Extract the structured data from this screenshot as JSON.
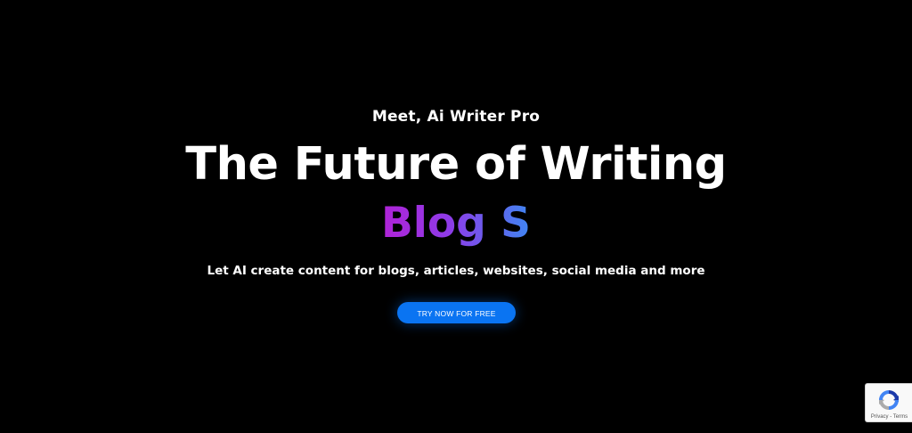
{
  "hero": {
    "eyebrow": "Meet, Ai Writer Pro",
    "headline": "The Future of Writing",
    "typed_text": "Blog S",
    "subheadline": "Let AI create content for blogs, articles, websites, social media and more",
    "cta_label": "TRY NOW FOR FREE"
  },
  "recaptcha": {
    "icon": "recaptcha-logo-icon",
    "privacy_label": "Privacy",
    "separator": " - ",
    "terms_label": "Terms"
  },
  "colors": {
    "background": "#000000",
    "text": "#ffffff",
    "cta_background": "#0a74f2",
    "gradient_start": "#b023d6",
    "gradient_end": "#3f86f2"
  }
}
